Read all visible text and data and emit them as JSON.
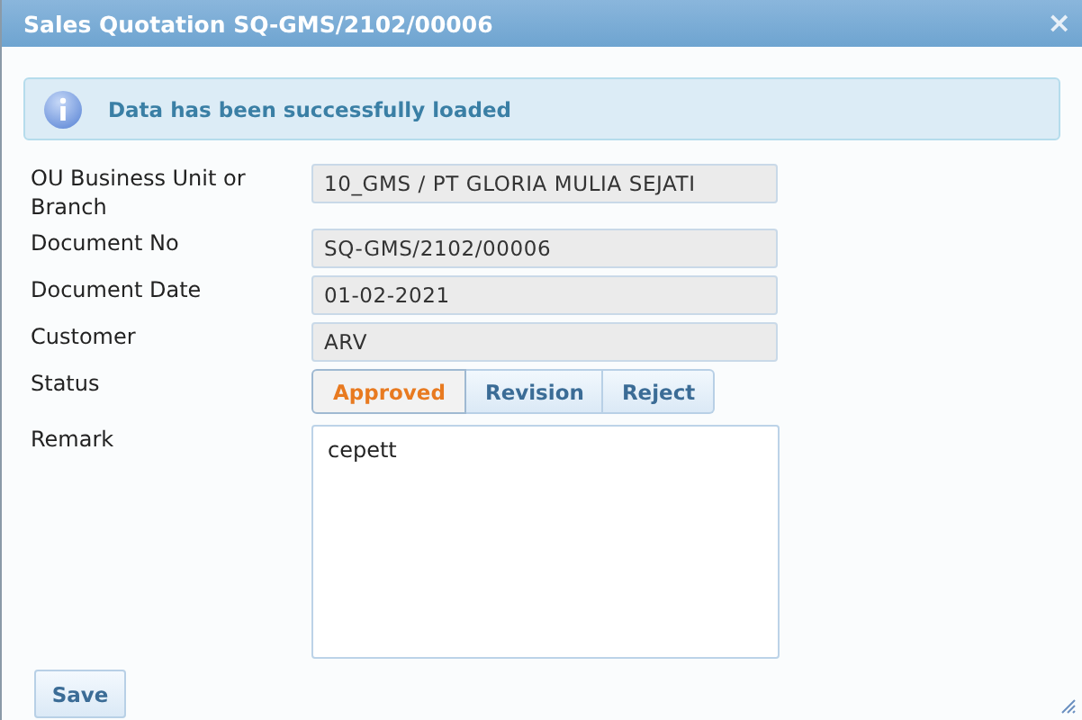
{
  "window": {
    "title": "Sales Quotation SQ-GMS/2102/00006",
    "close": "×"
  },
  "alert": {
    "message": "Data has been successfully loaded"
  },
  "fields": [
    {
      "label": "OU Business Unit or Branch",
      "value": "10_GMS / PT GLORIA MULIA SEJATI"
    },
    {
      "label": "Document No",
      "value": "SQ-GMS/2102/00006"
    },
    {
      "label": "Document Date",
      "value": "01-02-2021"
    },
    {
      "label": "Customer",
      "value": "ARV"
    }
  ],
  "status": {
    "label": "Status",
    "options": [
      {
        "label": "Approved",
        "selected": true
      },
      {
        "label": "Revision",
        "selected": false
      },
      {
        "label": "Reject",
        "selected": false
      }
    ]
  },
  "remark": {
    "label": "Remark",
    "value": "cepett"
  },
  "buttons": [
    "Save"
  ]
}
